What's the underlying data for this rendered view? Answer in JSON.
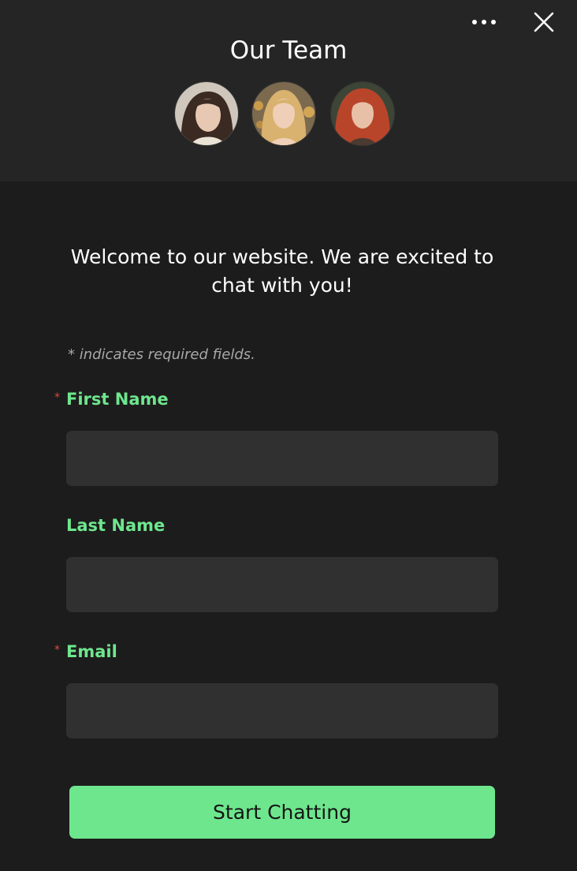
{
  "header": {
    "title": "Our Team",
    "more_icon": "more-horizontal-icon",
    "close_icon": "close-icon",
    "avatars": [
      {
        "name": "team-member-1",
        "hair_color": "#3b2a22",
        "skin_color": "#e7c8b2"
      },
      {
        "name": "team-member-2",
        "hair_color": "#d8b26e",
        "skin_color": "#efcfb7"
      },
      {
        "name": "team-member-3",
        "hair_color": "#b8452a",
        "skin_color": "#e8c0a8"
      }
    ]
  },
  "main": {
    "welcome_text": "Welcome to our website. We are excited to chat with you!",
    "required_note": "* indicates required fields.",
    "required_marker": "*",
    "fields": {
      "first_name": {
        "label": "First Name",
        "value": "",
        "placeholder": ""
      },
      "last_name": {
        "label": "Last Name",
        "value": "",
        "placeholder": ""
      },
      "email": {
        "label": "Email",
        "value": "",
        "placeholder": ""
      }
    },
    "submit_label": "Start Chatting"
  },
  "colors": {
    "accent": "#6ee68e",
    "required": "#e2483d",
    "background": "#1c1c1c",
    "header_background": "#252525",
    "input_background": "#303030"
  }
}
